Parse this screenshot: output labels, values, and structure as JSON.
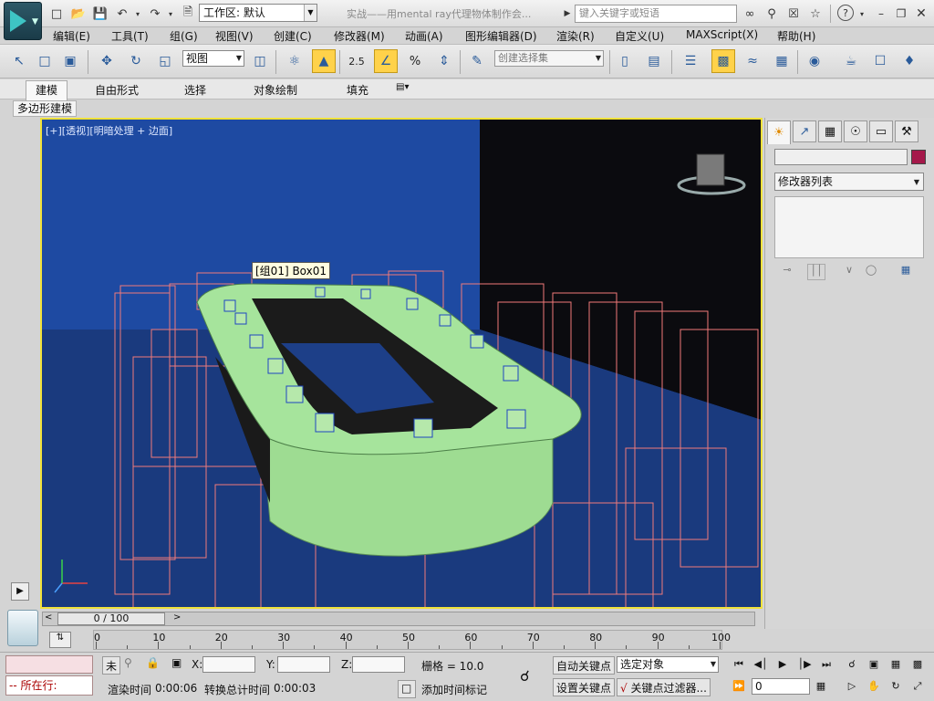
{
  "title_bar": {
    "workspace_label": "工作区: 默认",
    "document_title": "实战——用mental ray代理物体制作会...",
    "search_placeholder": "键入关键字或短语",
    "help_label": "?"
  },
  "menu": {
    "items": [
      "编辑(E)",
      "工具(T)",
      "组(G)",
      "视图(V)",
      "创建(C)",
      "修改器(M)",
      "动画(A)",
      "图形编辑器(D)",
      "渲染(R)",
      "自定义(U)",
      "MAXScript(X)",
      "帮助(H)"
    ]
  },
  "toolbar": {
    "reference_coord": "视图",
    "snap_value": "2.5",
    "percent_snap": "%",
    "selection_set_placeholder": "创建选择集"
  },
  "ribbon": {
    "tabs": [
      "建模",
      "自由形式",
      "选择",
      "对象绘制",
      "填充"
    ],
    "active_tab": "建模",
    "sub_panel": "多边形建模"
  },
  "viewport": {
    "label": "[+][透视][明暗处理 + 边面]",
    "tooltip": "[组01] Box01",
    "colors": {
      "background": "#1b3f88",
      "proxy_wire": "#f07a7a",
      "table": "#a4e29a",
      "border_active": "#f0e23a"
    }
  },
  "command_panel": {
    "tabs": [
      "create-icon",
      "modify-icon",
      "hierarchy-icon",
      "motion-icon",
      "display-icon",
      "utilities-icon"
    ],
    "modifier_list": "修改器列表",
    "object_color": "#a5184a"
  },
  "timeline": {
    "slider_label": "0 / 100",
    "ticks": [
      "0",
      "10",
      "20",
      "30",
      "40",
      "50",
      "60",
      "70",
      "80",
      "90",
      "100"
    ]
  },
  "status": {
    "script_line_label": "所在行:",
    "selection_mode": "未",
    "x_label": "X:",
    "y_label": "Y:",
    "z_label": "Z:",
    "grid_label": "栅格 = 10.0",
    "render_time_label": "渲染时间",
    "render_time_value": "0:00:06",
    "convert_time_label": "转换总计时间",
    "convert_time_value": "0:00:03",
    "add_time_tag": "添加时间标记",
    "auto_key": "自动关键点",
    "set_key": "设置关键点",
    "key_filter_dropdown": "选定对象",
    "key_filters": "关键点过滤器...",
    "frame_value": "0"
  }
}
